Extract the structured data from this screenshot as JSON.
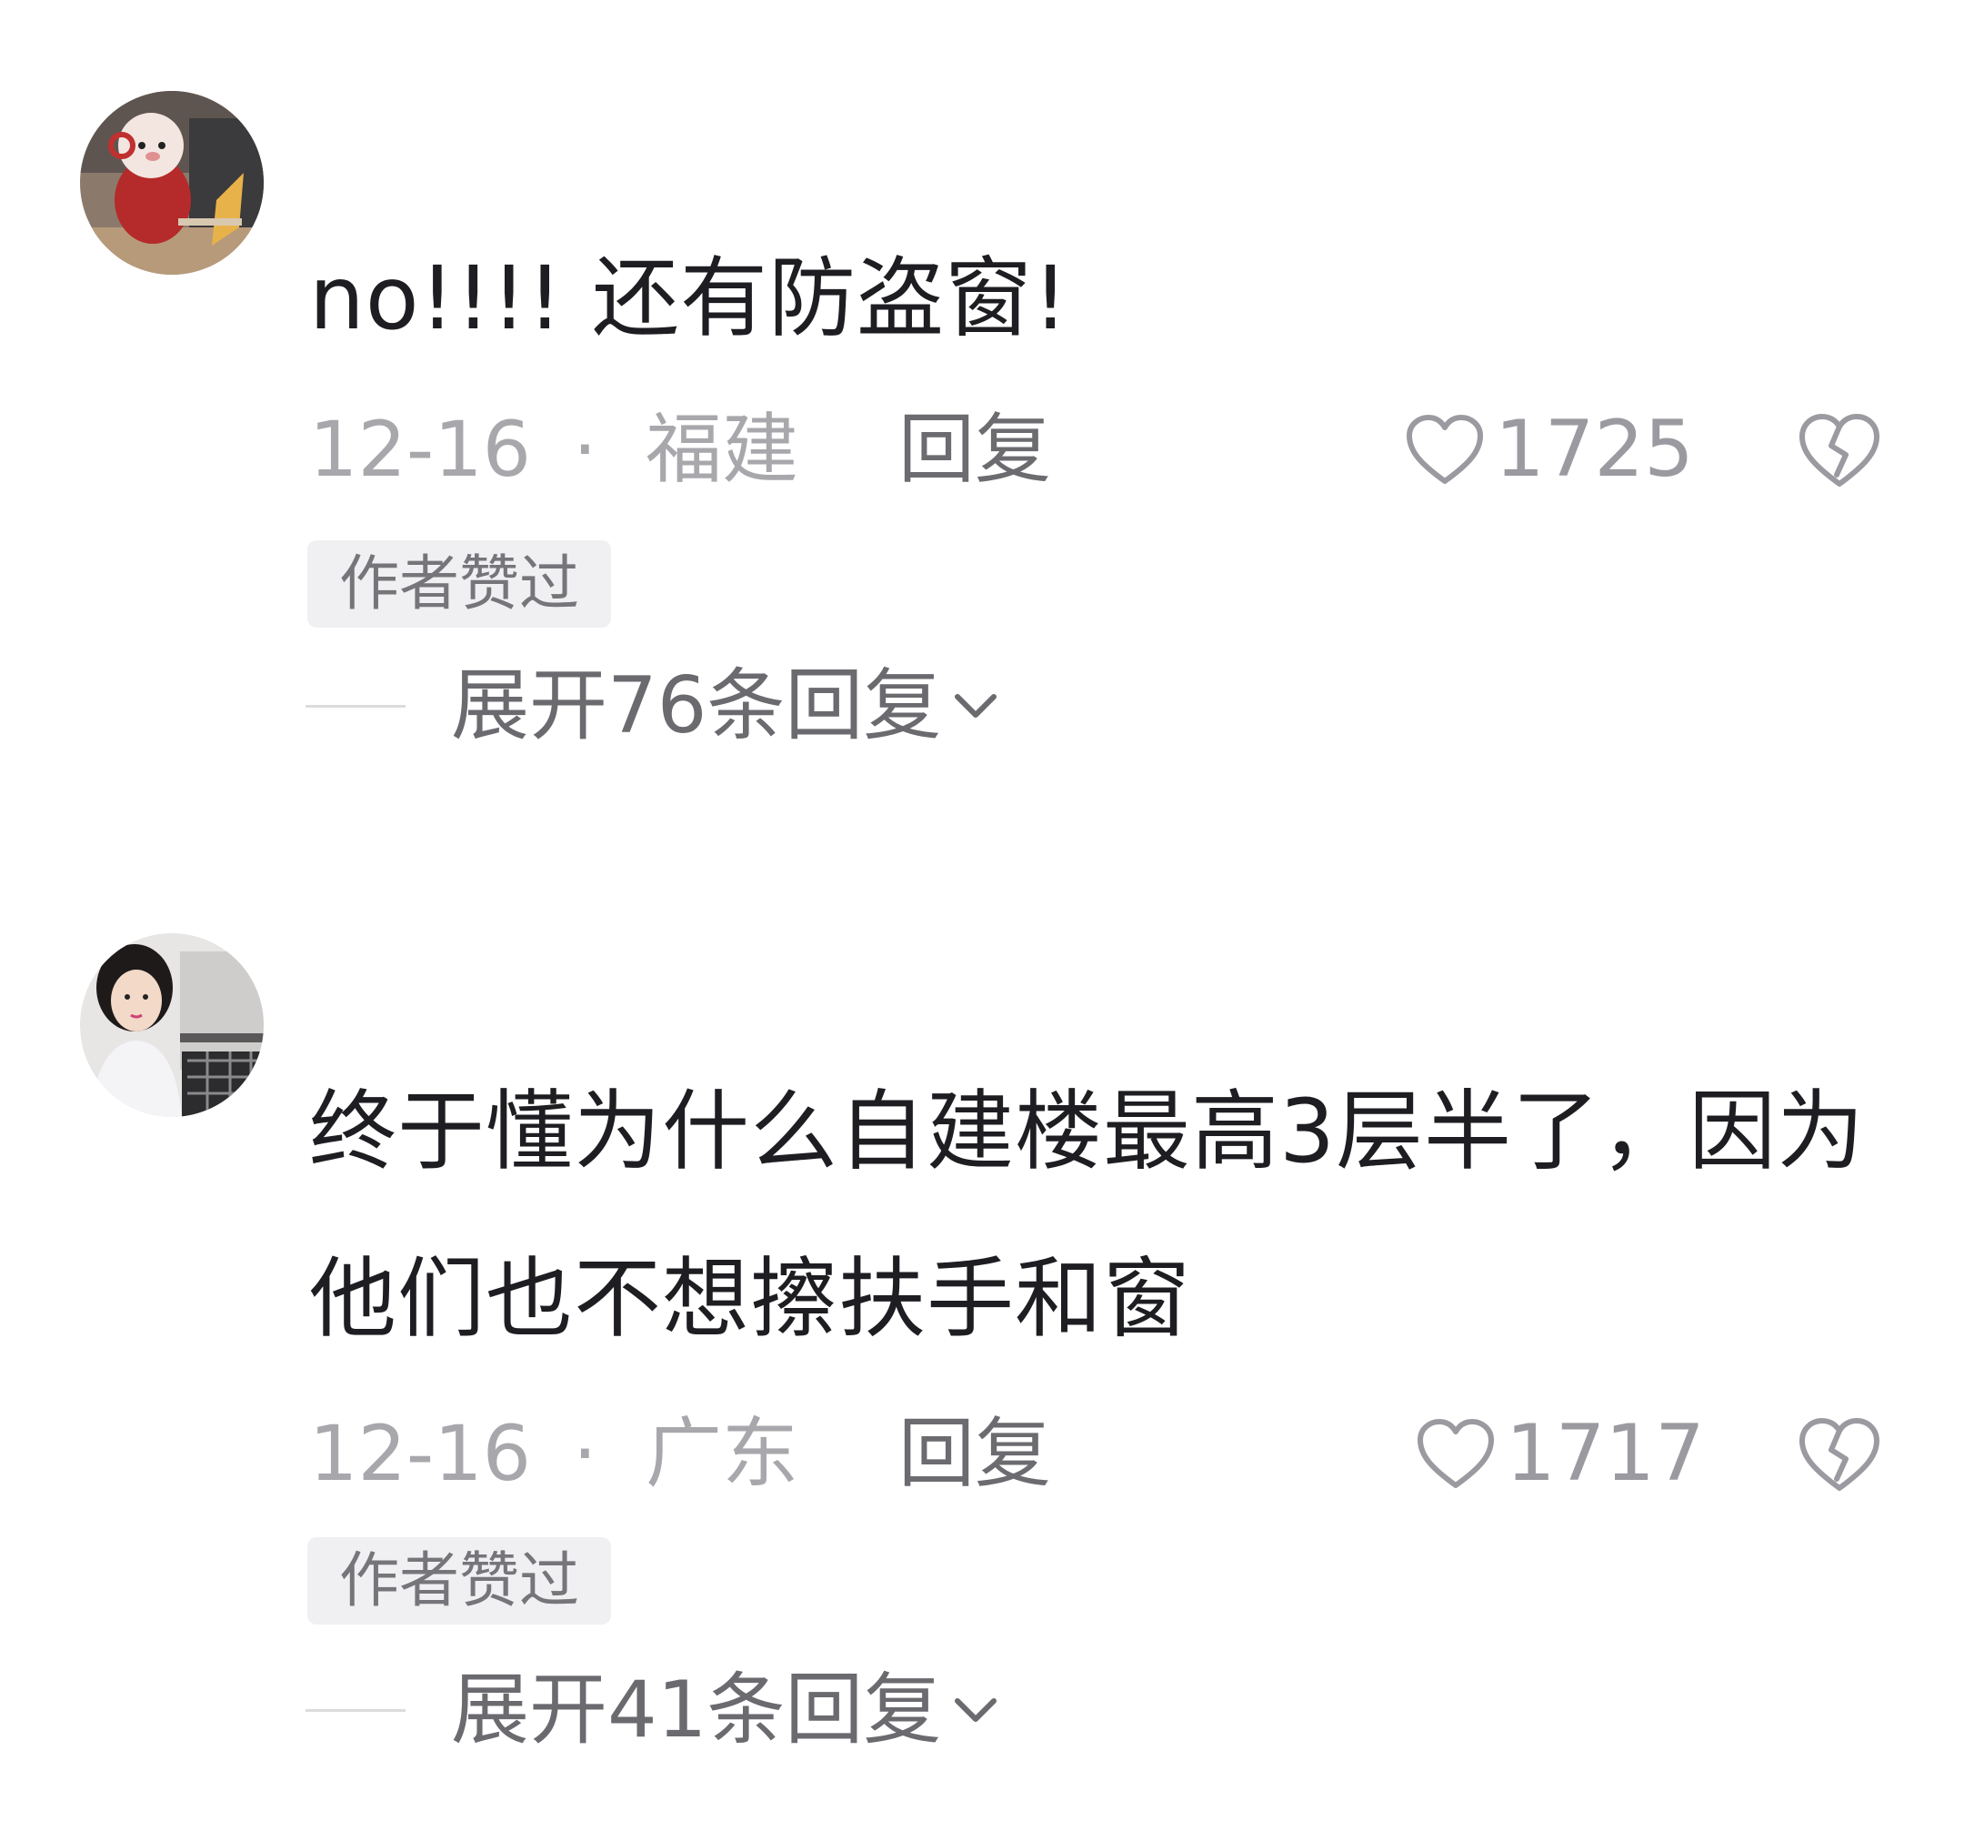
{
  "comments": [
    {
      "avatar": "avatar-plush-toy",
      "text": "no!!!! 还有防盗窗!",
      "date": "12-16",
      "separator": "·",
      "location": "福建",
      "reply_label": "回复",
      "like_icon": "heart-outline-icon",
      "like_count": "1725",
      "dislike_icon": "broken-heart-icon",
      "badge": "作者赞过",
      "expand_label": "展开76条回复",
      "expand_icon": "chevron-down-icon"
    },
    {
      "avatar": "avatar-girl-photo",
      "text": "终于懂为什么自建楼最高3层半了，因为他们也不想擦扶手和窗",
      "date": "12-16",
      "separator": "·",
      "location": "广东",
      "reply_label": "回复",
      "like_icon": "heart-outline-icon",
      "like_count": "1717",
      "dislike_icon": "broken-heart-icon",
      "badge": "作者赞过",
      "expand_label": "展开41条回复",
      "expand_icon": "chevron-down-icon"
    }
  ],
  "colors": {
    "text": "#1e1e22",
    "meta": "#a8a8ac",
    "reply": "#6b6b70",
    "badge_bg": "#f0f0f2",
    "divider": "#dcdcdf"
  }
}
